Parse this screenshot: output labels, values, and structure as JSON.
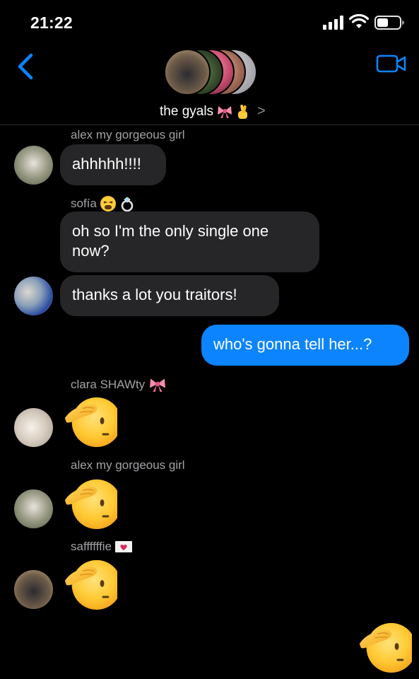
{
  "status": {
    "time": "21:22"
  },
  "header": {
    "group_name": "the gyals",
    "chevron": ">"
  },
  "messages": [
    {
      "sender": "alex my gorgeous girl",
      "text": "ahhhhh!!!!"
    },
    {
      "sender": "sofía",
      "text": "oh so I'm the only single one now?"
    },
    {
      "text": "thanks a lot you traitors!"
    },
    {
      "text": "who's gonna tell her...?",
      "outgoing": true
    },
    {
      "sender": "clara SHAWty",
      "emoji": "saluting-face"
    },
    {
      "sender": "alex my gorgeous girl",
      "emoji": "saluting-face"
    },
    {
      "sender": "saffffffie",
      "emoji": "saluting-face"
    },
    {
      "emoji": "saluting-face",
      "outgoing": true
    }
  ],
  "icons": {
    "back": "chevron-left-icon",
    "video": "video-camera-icon"
  },
  "colors": {
    "accent": "#0b84fe",
    "incoming_bubble": "#262628",
    "background": "#000000",
    "sender_text": "#a2a2a7"
  }
}
